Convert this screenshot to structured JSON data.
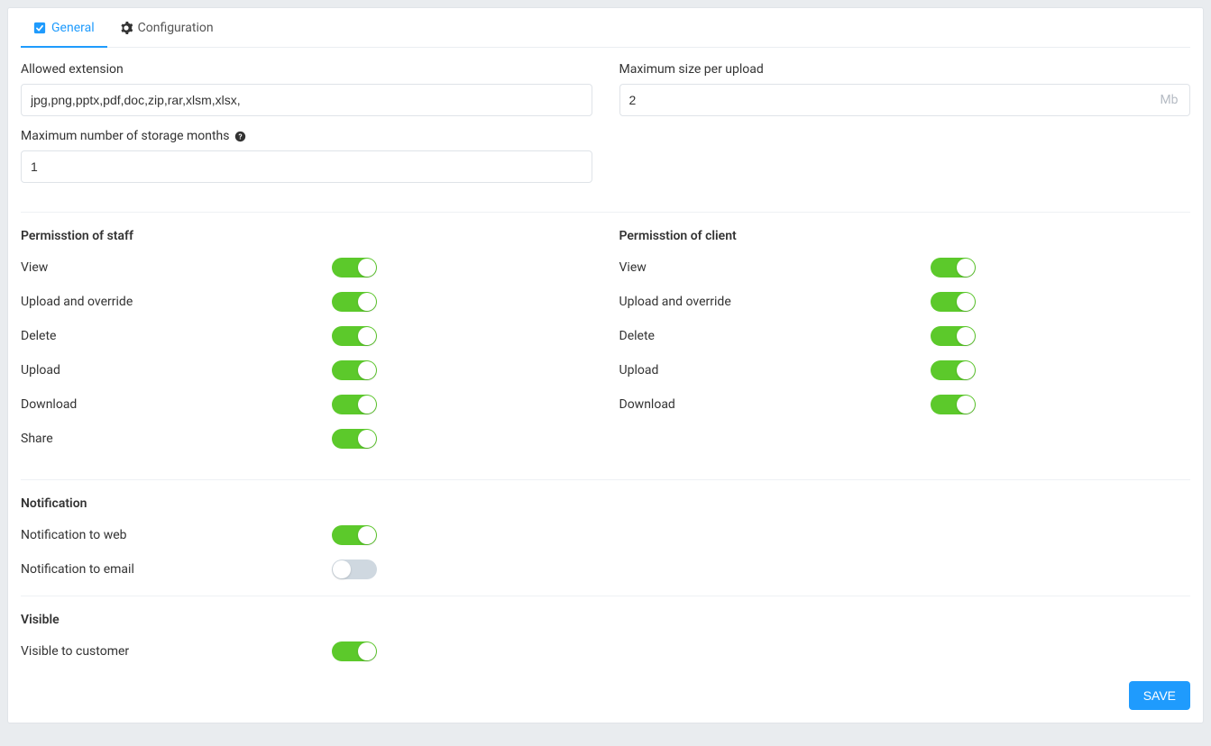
{
  "tabs": {
    "general": "General",
    "configuration": "Configuration"
  },
  "fields": {
    "allowed_extension": {
      "label": "Allowed extension",
      "value": "jpg,png,pptx,pdf,doc,zip,rar,xlsm,xlsx,"
    },
    "max_size": {
      "label": "Maximum size per upload",
      "value": "2",
      "unit": "Mb"
    },
    "max_storage_months": {
      "label": "Maximum number of storage months",
      "value": "1"
    }
  },
  "sections": {
    "staff_title": "Permisstion of staff",
    "client_title": "Permisstion of client",
    "notification_title": "Notification",
    "visible_title": "Visible"
  },
  "staff": {
    "view": {
      "label": "View",
      "on": true
    },
    "upload_override": {
      "label": "Upload and override",
      "on": true
    },
    "delete": {
      "label": "Delete",
      "on": true
    },
    "upload": {
      "label": "Upload",
      "on": true
    },
    "download": {
      "label": "Download",
      "on": true
    },
    "share": {
      "label": "Share",
      "on": true
    }
  },
  "client": {
    "view": {
      "label": "View",
      "on": true
    },
    "upload_override": {
      "label": "Upload and override",
      "on": true
    },
    "delete": {
      "label": "Delete",
      "on": true
    },
    "upload": {
      "label": "Upload",
      "on": true
    },
    "download": {
      "label": "Download",
      "on": true
    }
  },
  "notification": {
    "web": {
      "label": "Notification to web",
      "on": true
    },
    "email": {
      "label": "Notification to email",
      "on": false
    }
  },
  "visible": {
    "customer": {
      "label": "Visible to customer",
      "on": true
    }
  },
  "buttons": {
    "save": "SAVE"
  }
}
